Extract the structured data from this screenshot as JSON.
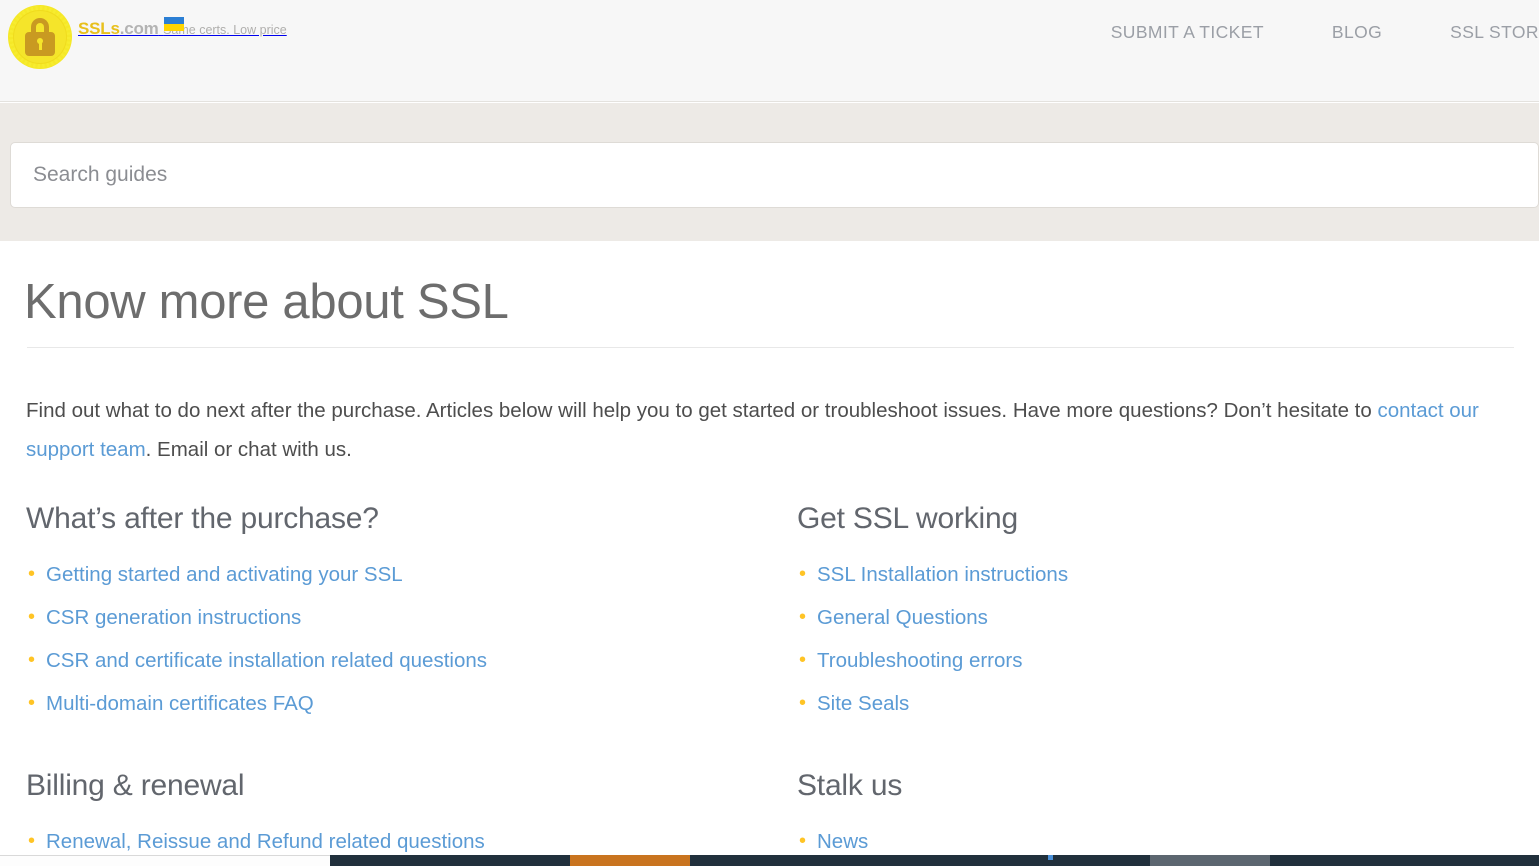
{
  "header": {
    "brand": {
      "logo_icon": "padlock-seal-icon",
      "name_primary": "SSLs",
      "name_suffix": ".com",
      "tagline": "Same certs. Low price",
      "flag_icon": "ukraine-flag-icon"
    },
    "nav": [
      {
        "id": "submit-a-ticket",
        "label": "SUBMIT A TICKET"
      },
      {
        "id": "blog",
        "label": "BLOG"
      },
      {
        "id": "ssl-store",
        "label": "SSL STORE"
      }
    ]
  },
  "search": {
    "placeholder": "Search guides",
    "value": ""
  },
  "main": {
    "title": "Know more about SSL",
    "intro_part1": "Find out what to do next after the purchase. Articles below will help you to get started or troubleshoot issues. Have more questions? Don’t hesitate to ",
    "intro_link": "contact our support team",
    "intro_part2": ". Email or chat with us."
  },
  "sections": {
    "left": [
      {
        "title": "What’s after the purchase?",
        "links": [
          "Getting started and activating your SSL",
          "CSR generation instructions",
          "CSR and certificate installation related questions",
          "Multi-domain certificates FAQ"
        ]
      },
      {
        "title": "Billing & renewal",
        "links": [
          "Renewal, Reissue and Refund related questions"
        ]
      }
    ],
    "right": [
      {
        "title": "Get SSL working",
        "links": [
          "SSL Installation instructions",
          "General Questions",
          "Troubleshooting errors",
          "Site Seals"
        ]
      },
      {
        "title": "Stalk us",
        "links": [
          "News"
        ]
      }
    ]
  },
  "colors": {
    "link_blue": "#5b9bd5",
    "bullet_gold": "#ffc425",
    "brand_gold": "#e8c01c",
    "header_bg": "#f7f7f7",
    "search_strip_bg": "#edeae6",
    "heading_gray": "#6d6d6d",
    "taskbar_dark": "#21303c",
    "taskbar_orange": "#c9741f"
  }
}
